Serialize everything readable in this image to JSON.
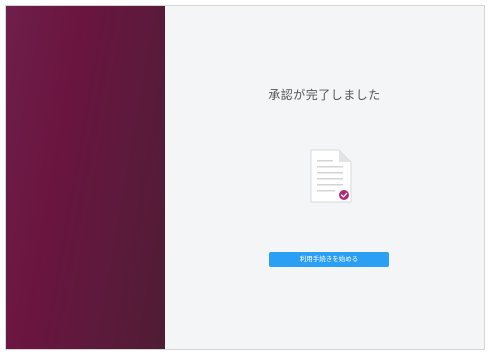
{
  "main": {
    "title": "承認が完了しました",
    "document_icon": "document-check-icon",
    "start_button_label": "利用手続きを始める"
  },
  "colors": {
    "left_panel": "#6a1540",
    "background": "#f4f5f6",
    "button": "#2b9ff3",
    "check_badge": "#b0287a"
  }
}
